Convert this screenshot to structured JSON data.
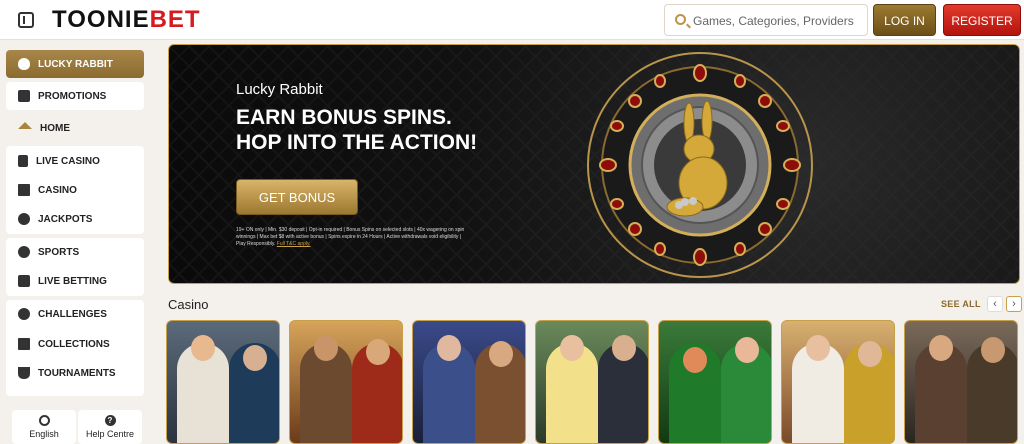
{
  "header": {
    "logo_main": "TOONIE",
    "logo_accent": "BET",
    "search_placeholder": "Games, Categories, Providers",
    "login_label": "LOG IN",
    "register_label": "REGISTER"
  },
  "sidebar": {
    "items": [
      {
        "label": "LUCKY RABBIT",
        "icon": "egg-icon"
      },
      {
        "label": "PROMOTIONS",
        "icon": "gift-icon"
      },
      {
        "label": "HOME",
        "icon": "home-icon"
      },
      {
        "label": "LIVE CASINO",
        "icon": "playing-card-icon"
      },
      {
        "label": "CASINO",
        "icon": "slot-machine-icon"
      },
      {
        "label": "JACKPOTS",
        "icon": "clover-icon"
      },
      {
        "label": "SPORTS",
        "icon": "rugby-ball-icon"
      },
      {
        "label": "LIVE BETTING",
        "icon": "live-badge-icon"
      },
      {
        "label": "CHALLENGES",
        "icon": "medal-icon"
      },
      {
        "label": "COLLECTIONS",
        "icon": "collection-icon"
      },
      {
        "label": "TOURNAMENTS",
        "icon": "trophy-icon"
      }
    ],
    "language_label": "English",
    "help_label": "Help Centre"
  },
  "banner": {
    "eyebrow": "Lucky Rabbit",
    "headline": "EARN BONUS SPINS. HOP INTO THE ACTION!",
    "cta_label": "GET BONUS",
    "terms_text": "19+ ON only | Min. $30 deposit | Opt-in required | Bonus Spins on selected slots | 40x wagering on spin winnings | Max bet $8 with active bonus | Spins expire in 24 Hours | Active withdrawals void eligibility | Play Responsibly.",
    "terms_link": "Full T&C apply."
  },
  "casino": {
    "title": "Casino",
    "see_all": "SEE ALL",
    "prev_icon": "chevron-left-icon",
    "next_icon": "chevron-right-icon"
  },
  "colors": {
    "accent_gold": "#a9874b",
    "register_red": "#d61a1f",
    "banner_bg": "#111111"
  }
}
